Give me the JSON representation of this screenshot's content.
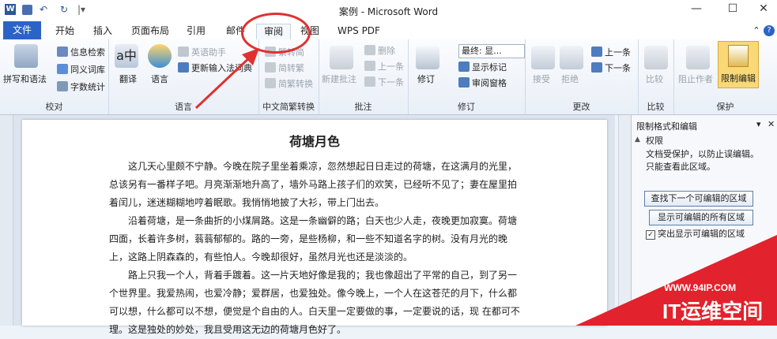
{
  "window": {
    "title": "案例 - Microsoft Word",
    "controls": {
      "minimize": "—",
      "maximize": "☐",
      "close": "✕"
    }
  },
  "quick_access": {
    "word_icon": "W",
    "save_icon": "save-icon",
    "undo": "↶",
    "redo": "↻",
    "customize": "|▾"
  },
  "tabs": [
    {
      "label": "文件"
    },
    {
      "label": "开始"
    },
    {
      "label": "插入"
    },
    {
      "label": "页面布局"
    },
    {
      "label": "引用"
    },
    {
      "label": "邮件"
    },
    {
      "label": "审阅"
    },
    {
      "label": "视图"
    },
    {
      "label": "WPS PDF"
    }
  ],
  "ribbon": {
    "proofing": {
      "name": "校对",
      "spell": "拼写和语法",
      "research": "信息检索",
      "thesaurus": "同义词库",
      "wordcount": "字数统计"
    },
    "language": {
      "name": "语言",
      "translate": "翻译",
      "lang": "语言",
      "assistant": "英语助手",
      "update_ime": "更新输入法词典"
    },
    "chinese": {
      "name": "中文简繁转换",
      "to_simp": "繁转简",
      "to_trad": "简转繁",
      "convert": "简繁转换"
    },
    "comments": {
      "name": "批注",
      "new": "新建批注",
      "delete": "删除",
      "prev": "上一条",
      "next": "下一条"
    },
    "tracking": {
      "name": "修订",
      "track": "修订",
      "final": "最终: 显...",
      "show_markup": "显示标记",
      "review_pane": "审阅窗格"
    },
    "changes": {
      "name": "更改",
      "accept": "接受",
      "reject": "拒绝",
      "prev": "上一条",
      "next": "下一条"
    },
    "compare": {
      "name": "比较",
      "compare": "比较"
    },
    "protect": {
      "name": "保护",
      "block_authors": "阻止作者",
      "restrict": "限制编辑"
    },
    "help": "?"
  },
  "document": {
    "title": "荷塘月色",
    "paragraphs": [
      "这几天心里颇不宁静。今晚在院子里坐着乘凉，忽然想起日日走过的荷塘，在这满月的光里，总该另有一番样子吧。月亮渐渐地升高了，墙外马路上孩子们的欢笑，已经听不见了；妻在屋里拍着闰儿，迷迷糊糊地哼着眠歌。我悄悄地披了大衫，带上门出去。",
      "沿着荷塘，是一条曲折的小煤屑路。这是一条幽僻的路；白天也少人走，夜晚更加寂寞。荷塘四面，长着许多树，蓊蓊郁郁的。路的一旁，是些杨柳，和一些不知道名字的树。没有月光的晚上，这路上阴森森的，有些怕人。今晚却很好，虽然月光也还是淡淡的。",
      "路上只我一个人，背着手踱着。这一片天地好像是我的；我也像超出了平常的自己，到了另一个世界里。我爱热闹，也爱冷静；爱群居，也爱独处。像今晚上，一个人在这苍茫的月下，什么都可以想，什么都可以不想，便觉是个自由的人。白天里一定要做的事，一定要说的话，现 在都可不理。这是独处的妙处，我且受用这无边的荷塘月色好了。"
    ]
  },
  "panel": {
    "title": "限制格式和编辑",
    "section": "权限",
    "desc": "文档受保护，以防止误编辑。只能查看此区域。",
    "find_next": "查找下一个可编辑的区域",
    "show_all": "显示可编辑的所有区域",
    "highlight": "突出显示可编辑的区域",
    "close": "✕",
    "menu": "▾"
  },
  "watermark": {
    "url": "WWW.94IP.COM",
    "brand": "IT运维空间"
  },
  "colors": {
    "file_tab": "#2b64c6",
    "accent": "#e03030",
    "restrict_highlight": "#f9d877"
  }
}
